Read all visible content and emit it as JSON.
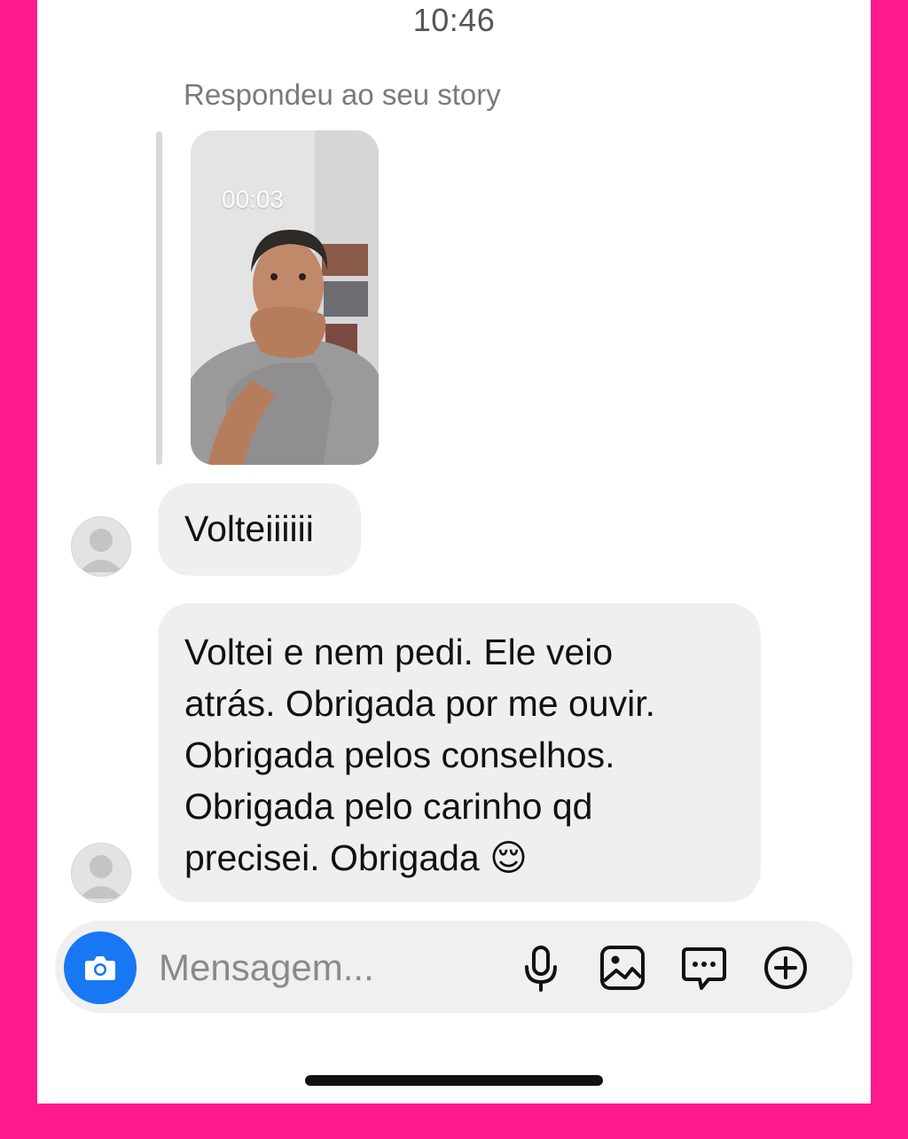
{
  "status_bar": {
    "time": "10:46"
  },
  "story_reply": {
    "caption": "Respondeu ao seu story",
    "duration": "00:03"
  },
  "messages": [
    {
      "text": "Volteiiiiii"
    },
    {
      "lines": [
        "Voltei e nem pedi. Ele veio",
        "atrás. Obrigada por me ouvir.",
        "Obrigada pelos conselhos.",
        "Obrigada pelo carinho qd",
        "precisei. Obrigada 😌"
      ]
    }
  ],
  "composer": {
    "placeholder": "Mensagem...",
    "icons": [
      "camera-icon",
      "microphone-icon",
      "gallery-icon",
      "sticker-icon",
      "plus-icon"
    ]
  },
  "colors": {
    "frame": "#ff1a8c",
    "accent": "#1877f2",
    "bubble": "#efefef"
  }
}
